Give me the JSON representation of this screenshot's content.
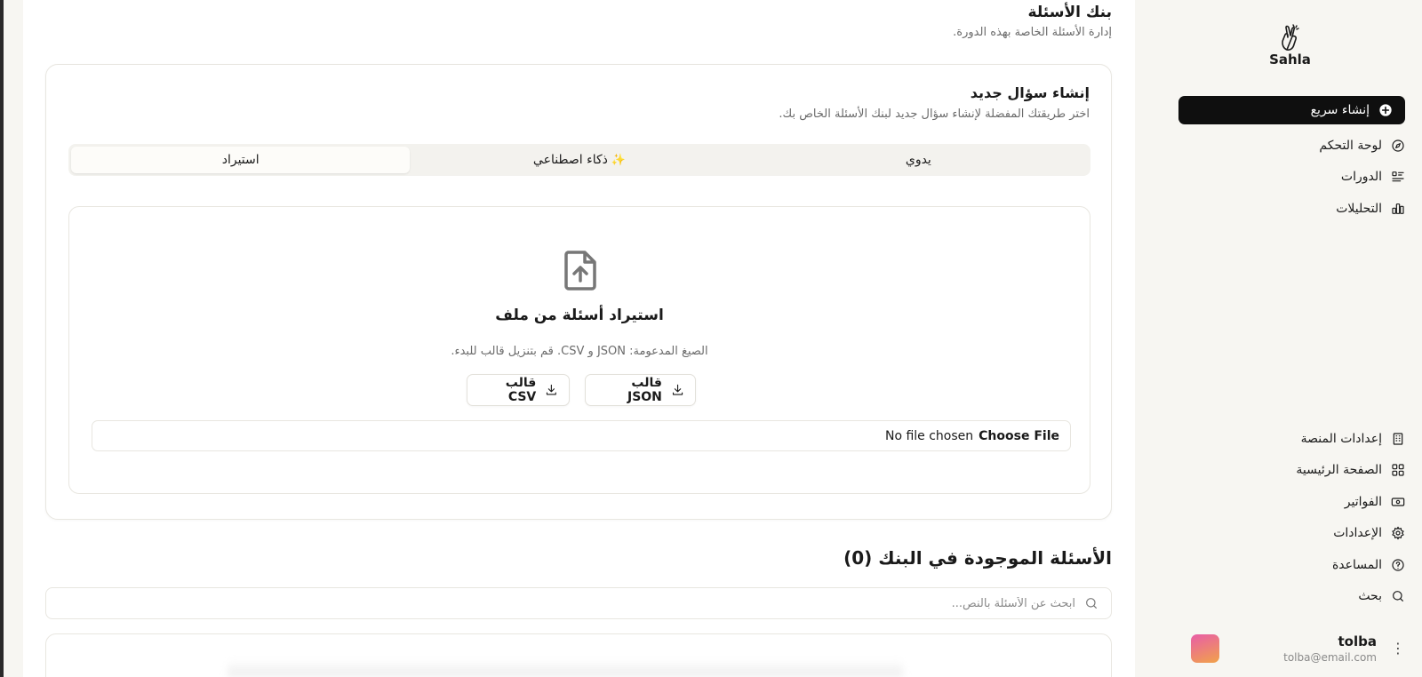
{
  "page": {
    "title": "بنك الأسئلة",
    "subtitle": "إدارة الأسئلة الخاصة بهذه الدورة."
  },
  "create": {
    "title": "إنشاء سؤال جديد",
    "description": "اختر طريقتك المفضلة لإنشاء سؤال جديد لبنك الأسئلة الخاص بك.",
    "tabs": [
      {
        "label": "يدوي",
        "active": false
      },
      {
        "label": "ذكاء اصطناعي",
        "icon": "sparkles-icon",
        "active": false
      },
      {
        "label": "استيراد",
        "active": true
      }
    ],
    "import": {
      "title": "استيراد أسئلة من ملف",
      "formats": "الصيغ المدعومة: JSON و CSV. قم بتنزيل قالب للبدء.",
      "json_template": "قالب JSON",
      "csv_template": "قالب CSV",
      "choose_file": "Choose File",
      "no_file": "No file chosen"
    }
  },
  "bank": {
    "title": "الأسئلة الموجودة في البنك (0)",
    "search_placeholder": "ابحث عن الأسئلة بالنص..."
  },
  "sidebar": {
    "logo_text": "Sahla",
    "quick_create": "إنشاء سريع",
    "top_nav": [
      {
        "label": "لوحة التحكم",
        "icon": "compass-icon"
      },
      {
        "label": "الدورات",
        "icon": "list-icon"
      },
      {
        "label": "التحليلات",
        "icon": "bar-chart-icon"
      }
    ],
    "bottom_nav": [
      {
        "label": "إعدادات المنصة",
        "icon": "building-icon"
      },
      {
        "label": "الصفحة الرئيسية",
        "icon": "grid-icon"
      },
      {
        "label": "الفواتير",
        "icon": "banknote-icon"
      },
      {
        "label": "الإعدادات",
        "icon": "gear-icon"
      },
      {
        "label": "المساعدة",
        "icon": "help-icon"
      },
      {
        "label": "بحث",
        "icon": "search-icon"
      }
    ],
    "user": {
      "name": "tolba",
      "email": "tolba@email.com"
    }
  },
  "colors": {
    "background": "#f7f6f2",
    "primary_button": "#0f0f0f",
    "border": "#e8e6e0",
    "avatar_gradient_start": "#e85da8",
    "avatar_gradient_end": "#f1a24a"
  }
}
